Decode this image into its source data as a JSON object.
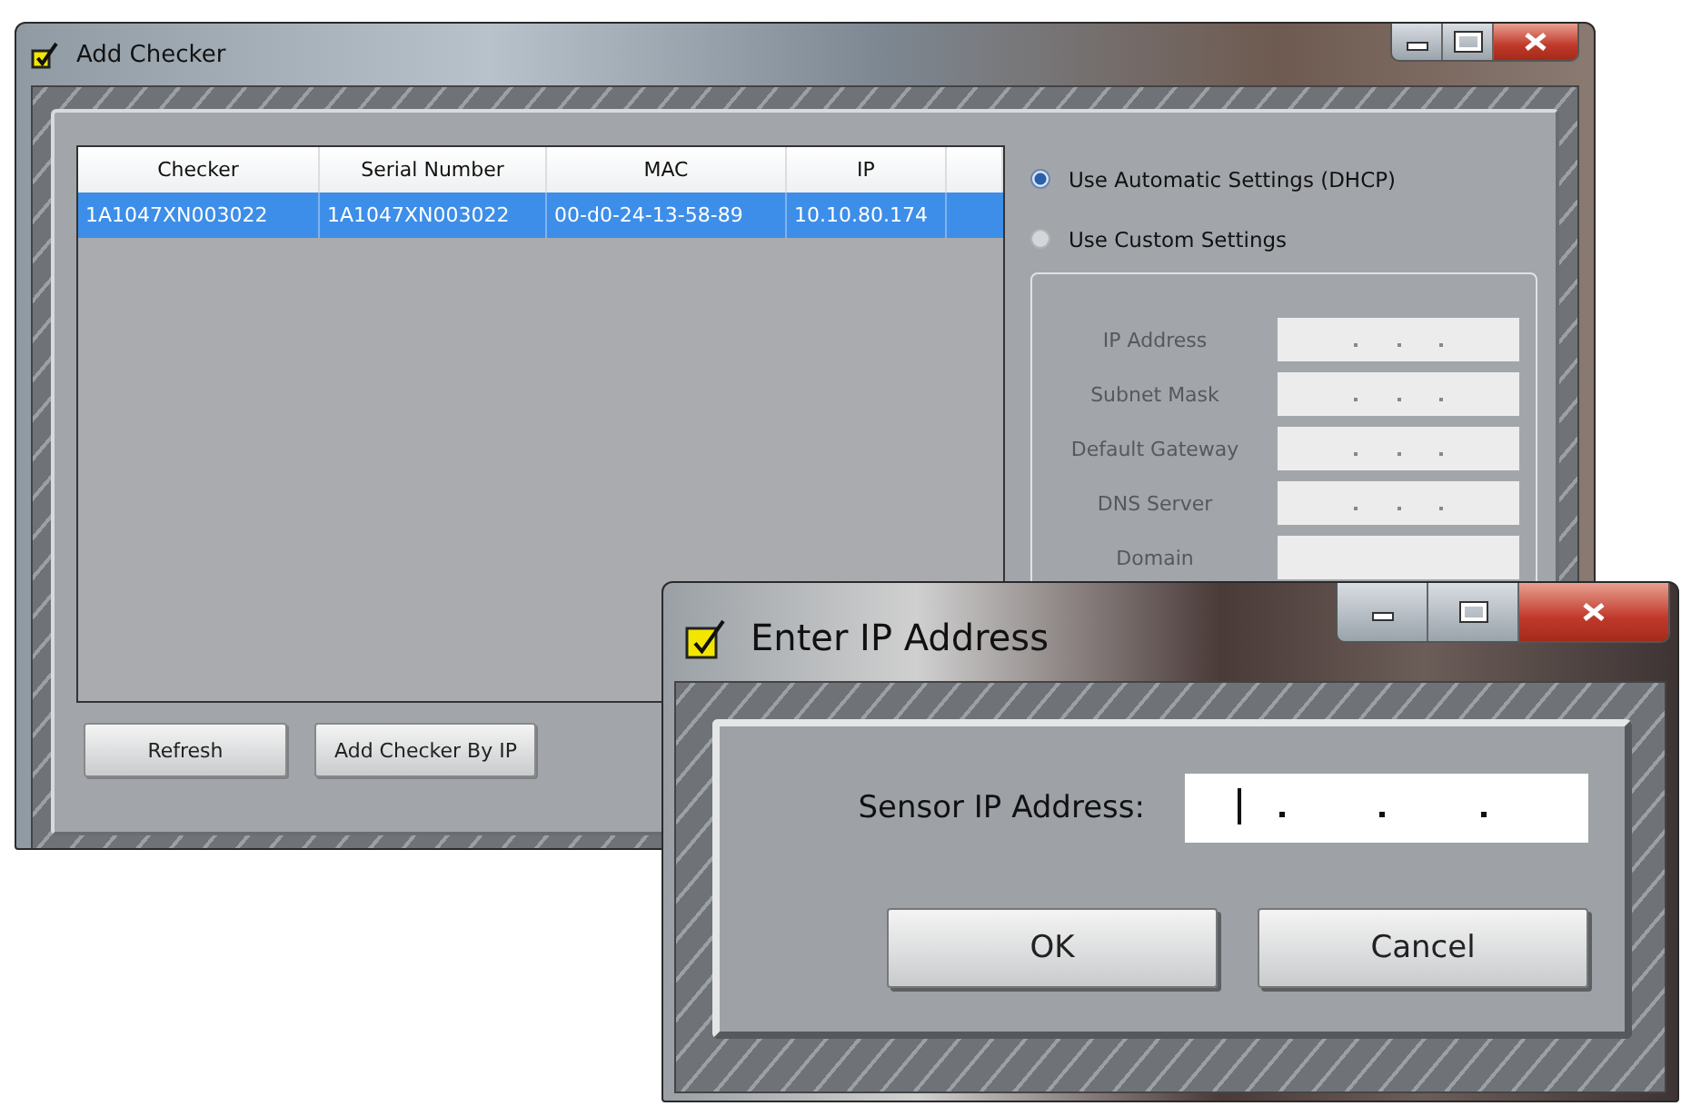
{
  "windows": [
    {
      "kind": "main",
      "title": "Add Checker",
      "table": {
        "columns": [
          "Checker",
          "Serial Number",
          "MAC",
          "IP"
        ],
        "rows": [
          {
            "cells": [
              "1A1047XN003022",
              "1A1047XN003022",
              "00-d0-24-13-58-89",
              "10.10.80.174"
            ],
            "selected": true
          }
        ]
      },
      "buttons": [
        "Refresh",
        "Add Checker By IP"
      ],
      "network": {
        "options": [
          {
            "label": "Use Automatic Settings (DHCP)",
            "selected": true
          },
          {
            "label": "Use Custom Settings",
            "selected": false
          }
        ],
        "disabled": true,
        "fields": [
          {
            "label": "IP Address",
            "kind": "ip"
          },
          {
            "label": "Subnet Mask",
            "kind": "ip"
          },
          {
            "label": "Default Gateway",
            "kind": "ip"
          },
          {
            "label": "DNS Server",
            "kind": "ip"
          },
          {
            "label": "Domain",
            "kind": "text"
          }
        ]
      }
    },
    {
      "kind": "dialog",
      "title": "Enter IP Address",
      "field": {
        "label": "Sensor IP Address:",
        "kind": "ip",
        "focused": true
      },
      "buttons": [
        "OK",
        "Cancel"
      ]
    }
  ]
}
